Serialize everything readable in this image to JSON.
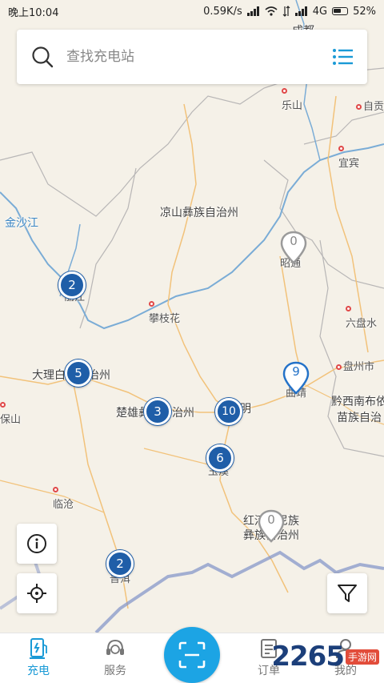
{
  "status": {
    "time": "晚上10:04",
    "speed": "0.59K/s",
    "network": "4G",
    "battery": "52%"
  },
  "search": {
    "placeholder": "查找充电站"
  },
  "map": {
    "places": [
      {
        "id": "chengdu",
        "label": "成都",
        "dot": false
      },
      {
        "id": "leshan",
        "label": "乐山",
        "dot": true
      },
      {
        "id": "zigong",
        "label": "自贡",
        "dot": true
      },
      {
        "id": "yibin",
        "label": "宜宾",
        "dot": true
      },
      {
        "id": "liangshan",
        "label": "凉山彝族自治州",
        "dot": true
      },
      {
        "id": "jinshajiang",
        "label": "金沙江",
        "dot": false
      },
      {
        "id": "lijiang",
        "label": "丽江",
        "dot": true
      },
      {
        "id": "panzhihua",
        "label": "攀枝花",
        "dot": true
      },
      {
        "id": "zhaotong",
        "label": "昭通",
        "dot": true
      },
      {
        "id": "liupanshui",
        "label": "六盘水",
        "dot": true
      },
      {
        "id": "dali",
        "label": "大理白族自治州",
        "dot": false
      },
      {
        "id": "panzhou",
        "label": "盘州市",
        "dot": true
      },
      {
        "id": "qujing",
        "label": "曲靖",
        "dot": false
      },
      {
        "id": "qianxinan1",
        "label": "黔西南布依",
        "dot": false
      },
      {
        "id": "qianxinan2",
        "label": "苗族自治",
        "dot": false
      },
      {
        "id": "baoshan",
        "label": "保山",
        "dot": true
      },
      {
        "id": "chuxiong",
        "label": "楚雄彝族自治州",
        "dot": false
      },
      {
        "id": "kunming",
        "label": "明",
        "dot": false
      },
      {
        "id": "yuxi",
        "label": "玉溪",
        "dot": false
      },
      {
        "id": "lincang",
        "label": "临沧",
        "dot": true
      },
      {
        "id": "honghe1",
        "label": "红河哈尼族",
        "dot": false
      },
      {
        "id": "honghe2",
        "label": "彝族自治州",
        "dot": false
      },
      {
        "id": "puer",
        "label": "普洱",
        "dot": false
      }
    ],
    "clusters": [
      {
        "id": "lijiang",
        "count": "2"
      },
      {
        "id": "dali",
        "count": "5"
      },
      {
        "id": "chuxiong",
        "count": "3"
      },
      {
        "id": "kunming",
        "count": "10"
      },
      {
        "id": "yuxi",
        "count": "6"
      },
      {
        "id": "puer",
        "count": "2"
      }
    ],
    "pins": [
      {
        "id": "zhaotong",
        "count": "0",
        "style": "gray"
      },
      {
        "id": "qujing",
        "count": "9",
        "style": "blue"
      },
      {
        "id": "honghe",
        "count": "0",
        "style": "gray"
      }
    ]
  },
  "tabs": [
    {
      "id": "charge",
      "label": "充电",
      "icon": "charging-station-icon",
      "active": true
    },
    {
      "id": "service",
      "label": "服务",
      "icon": "headset-icon",
      "active": false
    },
    {
      "id": "scan",
      "label": "",
      "icon": "scan-icon",
      "active": false
    },
    {
      "id": "orders",
      "label": "订单",
      "icon": "order-list-icon",
      "active": false
    },
    {
      "id": "mine",
      "label": "我的",
      "icon": "person-icon",
      "active": false
    }
  ],
  "watermark": {
    "number": "2265",
    "text": "手游网"
  },
  "colors": {
    "accent": "#1ca4e4",
    "cluster": "#1f5ea8",
    "tab_active": "#1a9ad6"
  }
}
